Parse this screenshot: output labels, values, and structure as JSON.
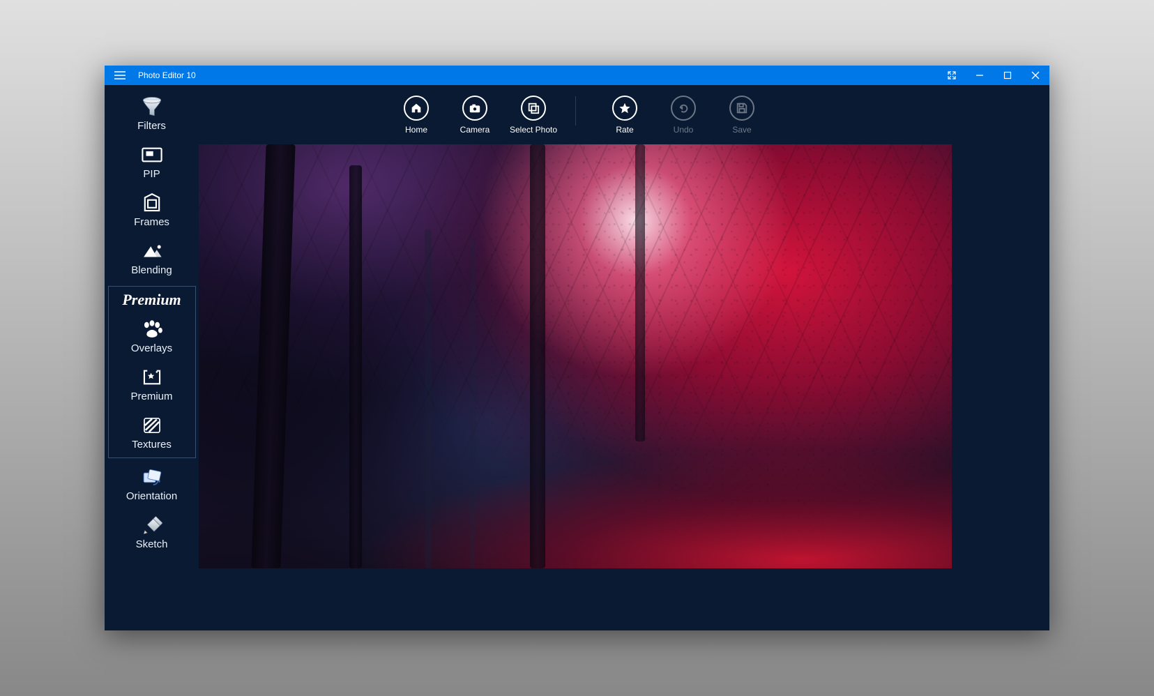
{
  "window": {
    "title": "Photo Editor 10"
  },
  "toolbar": {
    "home": "Home",
    "camera": "Camera",
    "select_photo": "Select Photo",
    "rate": "Rate",
    "undo": "Undo",
    "save": "Save"
  },
  "sidebar": {
    "filters": "Filters",
    "pip": "PIP",
    "frames": "Frames",
    "blending": "Blending",
    "premium_header": "Premium",
    "overlays": "Overlays",
    "premium": "Premium",
    "textures": "Textures",
    "orientation": "Orientation",
    "sketch": "Sketch"
  }
}
